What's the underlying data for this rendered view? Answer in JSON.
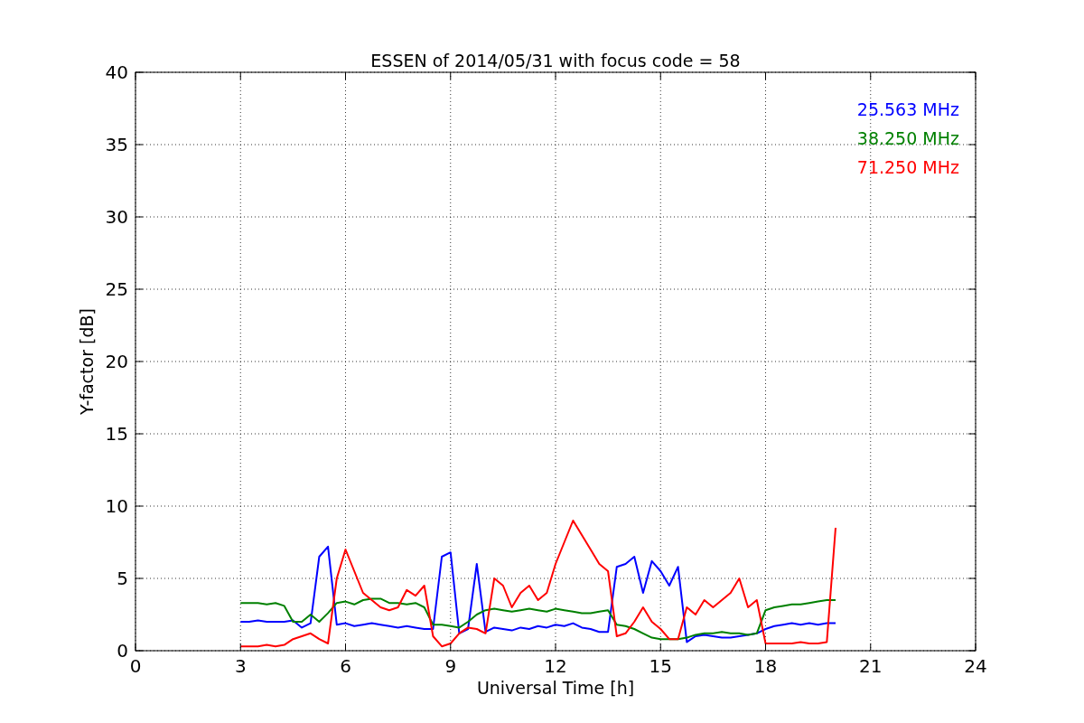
{
  "chart_data": {
    "type": "line",
    "title": "ESSEN of 2014/05/31 with focus code = 58",
    "xlabel": "Universal Time [h]",
    "ylabel": "Y-factor [dB]",
    "x": [
      3,
      3.25,
      3.5,
      3.75,
      4,
      4.25,
      4.5,
      4.75,
      5,
      5.25,
      5.5,
      5.75,
      6,
      6.25,
      6.5,
      6.75,
      7,
      7.25,
      7.5,
      7.75,
      8,
      8.25,
      8.5,
      8.75,
      9,
      9.25,
      9.5,
      9.75,
      10,
      10.25,
      10.5,
      10.75,
      11,
      11.25,
      11.5,
      11.75,
      12,
      12.25,
      12.5,
      12.75,
      13,
      13.25,
      13.5,
      13.75,
      14,
      14.25,
      14.5,
      14.75,
      15,
      15.25,
      15.5,
      15.75,
      16,
      16.25,
      16.5,
      16.75,
      17,
      17.25,
      17.5,
      17.75,
      18,
      18.25,
      18.5,
      18.75,
      19,
      19.25,
      19.5,
      19.75,
      20
    ],
    "series": [
      {
        "name": "25.563 MHz",
        "color": "#0000ff",
        "values": [
          2.0,
          2.0,
          2.1,
          2.0,
          2.0,
          2.0,
          2.1,
          1.6,
          1.9,
          6.5,
          7.2,
          1.8,
          1.9,
          1.7,
          1.8,
          1.9,
          1.8,
          1.7,
          1.6,
          1.7,
          1.6,
          1.5,
          1.5,
          6.5,
          6.8,
          1.2,
          1.5,
          6.0,
          1.3,
          1.6,
          1.5,
          1.4,
          1.6,
          1.5,
          1.7,
          1.6,
          1.8,
          1.7,
          1.9,
          1.6,
          1.5,
          1.3,
          1.3,
          5.8,
          6.0,
          6.5,
          4.0,
          6.2,
          5.5,
          4.5,
          5.8,
          0.6,
          1.0,
          1.1,
          1.0,
          0.9,
          0.9,
          1.0,
          1.1,
          1.2,
          1.5,
          1.7,
          1.8,
          1.9,
          1.8,
          1.9,
          1.8,
          1.9,
          1.9
        ]
      },
      {
        "name": "38.250 MHz",
        "color": "#008000",
        "values": [
          3.3,
          3.3,
          3.3,
          3.2,
          3.3,
          3.1,
          2.0,
          2.0,
          2.5,
          2.0,
          2.6,
          3.3,
          3.4,
          3.2,
          3.5,
          3.6,
          3.6,
          3.3,
          3.3,
          3.2,
          3.3,
          3.0,
          1.8,
          1.8,
          1.7,
          1.6,
          2.0,
          2.5,
          2.8,
          2.9,
          2.8,
          2.7,
          2.8,
          2.9,
          2.8,
          2.7,
          2.9,
          2.8,
          2.7,
          2.6,
          2.6,
          2.7,
          2.8,
          1.8,
          1.7,
          1.5,
          1.2,
          0.9,
          0.8,
          0.8,
          0.8,
          0.9,
          1.1,
          1.2,
          1.2,
          1.3,
          1.2,
          1.2,
          1.1,
          1.2,
          2.8,
          3.0,
          3.1,
          3.2,
          3.2,
          3.3,
          3.4,
          3.5,
          3.5
        ]
      },
      {
        "name": "71.250 MHz",
        "color": "#ff0000",
        "values": [
          0.3,
          0.3,
          0.3,
          0.4,
          0.3,
          0.4,
          0.8,
          1.0,
          1.2,
          0.8,
          0.5,
          5.0,
          7.0,
          5.5,
          4.0,
          3.5,
          3.0,
          2.8,
          3.0,
          4.2,
          3.8,
          4.5,
          1.0,
          0.3,
          0.5,
          1.2,
          1.6,
          1.5,
          1.2,
          5.0,
          4.5,
          3.0,
          4.0,
          4.5,
          3.5,
          4.0,
          6.0,
          7.5,
          9.0,
          8.0,
          7.0,
          6.0,
          5.5,
          1.0,
          1.2,
          2.0,
          3.0,
          2.0,
          1.5,
          0.8,
          0.8,
          3.0,
          2.5,
          3.5,
          3.0,
          3.5,
          4.0,
          5.0,
          3.0,
          3.5,
          0.5,
          0.5,
          0.5,
          0.5,
          0.6,
          0.5,
          0.5,
          0.6,
          8.5
        ]
      }
    ],
    "grid": true,
    "xlim": [
      0,
      24
    ],
    "ylim": [
      0,
      40
    ],
    "xticks": [
      0,
      3,
      6,
      9,
      12,
      15,
      18,
      21,
      24
    ],
    "yticks": [
      0,
      5,
      10,
      15,
      20,
      25,
      30,
      35,
      40
    ]
  }
}
